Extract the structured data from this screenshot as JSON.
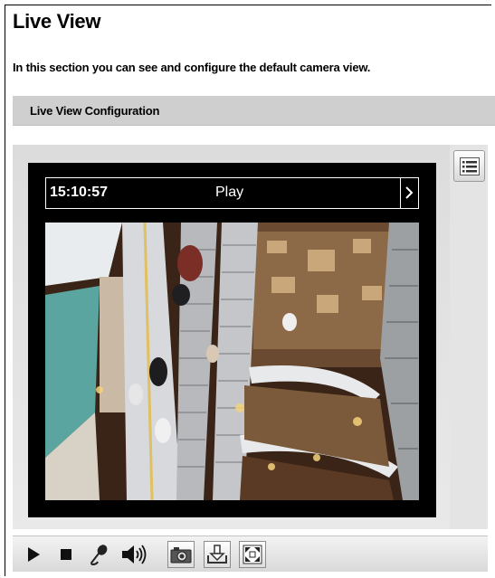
{
  "page": {
    "title": "Live View",
    "intro": "In this section you can see and configure the default camera view."
  },
  "section": {
    "title": "Live View Configuration"
  },
  "player": {
    "time": "15:10:57",
    "state": "Play"
  },
  "icons": {
    "menu": "list-menu-icon",
    "next": "chevron-right-icon",
    "play": "play-icon",
    "stop": "stop-icon",
    "microphone": "microphone-icon",
    "speaker": "speaker-icon",
    "snapshot": "camera-snapshot-icon",
    "download": "download-icon",
    "fullscreen": "fullscreen-icon"
  },
  "colors": {
    "video_background": "#000000",
    "status_text": "#ffffff",
    "section_bar": "#cfcfcf"
  }
}
